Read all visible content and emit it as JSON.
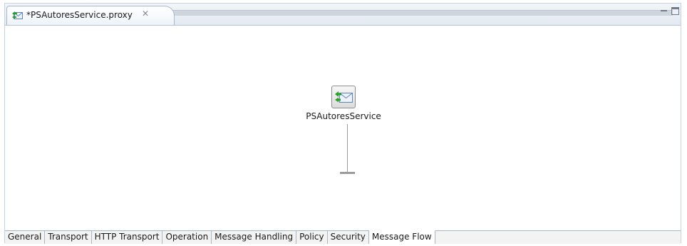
{
  "editor": {
    "tab_title": "*PSAutoresService.proxy",
    "tab_icon": "proxy-service-icon",
    "close_glyph": "✕"
  },
  "view_controls": {
    "minimize": "minimize-icon",
    "maximize": "maximize-icon"
  },
  "canvas": {
    "node_label": "PSAutoresService",
    "node_icon": "proxy-service-node-icon"
  },
  "page_tabs": [
    {
      "label": "General",
      "active": false
    },
    {
      "label": "Transport",
      "active": false
    },
    {
      "label": "HTTP Transport",
      "active": false
    },
    {
      "label": "Operation",
      "active": false
    },
    {
      "label": "Message Handling",
      "active": false
    },
    {
      "label": "Policy",
      "active": false
    },
    {
      "label": "Security",
      "active": false
    },
    {
      "label": "Message Flow",
      "active": true
    }
  ],
  "colors": {
    "accent": "#2f9e2f",
    "envelope": "#5b84c4",
    "border": "#a9b6c6"
  }
}
